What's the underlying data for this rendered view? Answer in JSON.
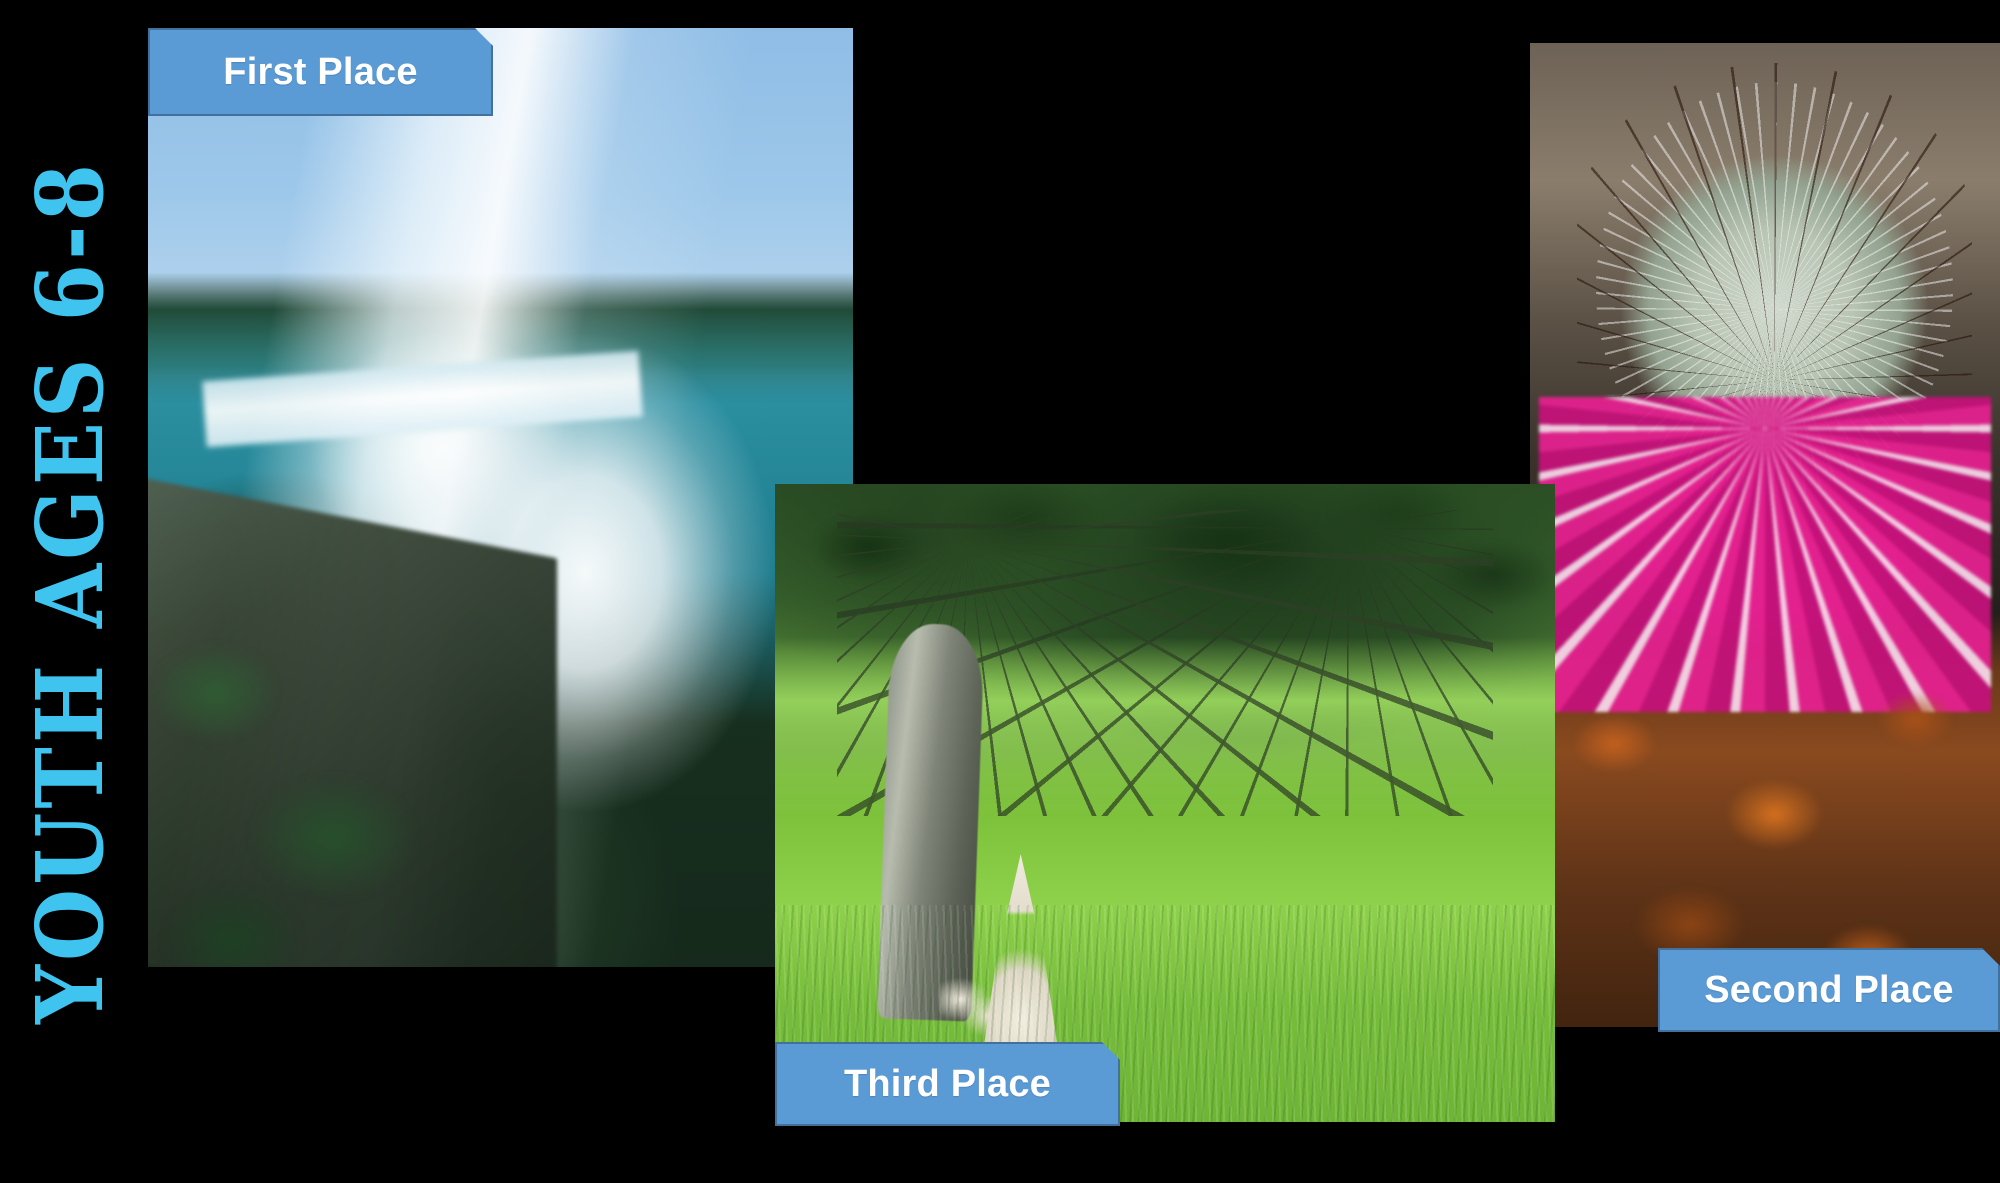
{
  "slide": {
    "background_color": "#000000",
    "side_title": "YOUTH AGES 6-8",
    "side_title_color": "#3FC4F0",
    "caption_fill_color": "#5B9BD5",
    "caption_border_color": "#41719C",
    "caption_text_color": "#FFFFFF"
  },
  "entries": [
    {
      "caption": "First Place",
      "subject": "waterfall-photo"
    },
    {
      "caption": "Second Place",
      "subject": "cactus-flower-photo"
    },
    {
      "caption": "Third Place",
      "subject": "garden-gnome-photo"
    }
  ]
}
